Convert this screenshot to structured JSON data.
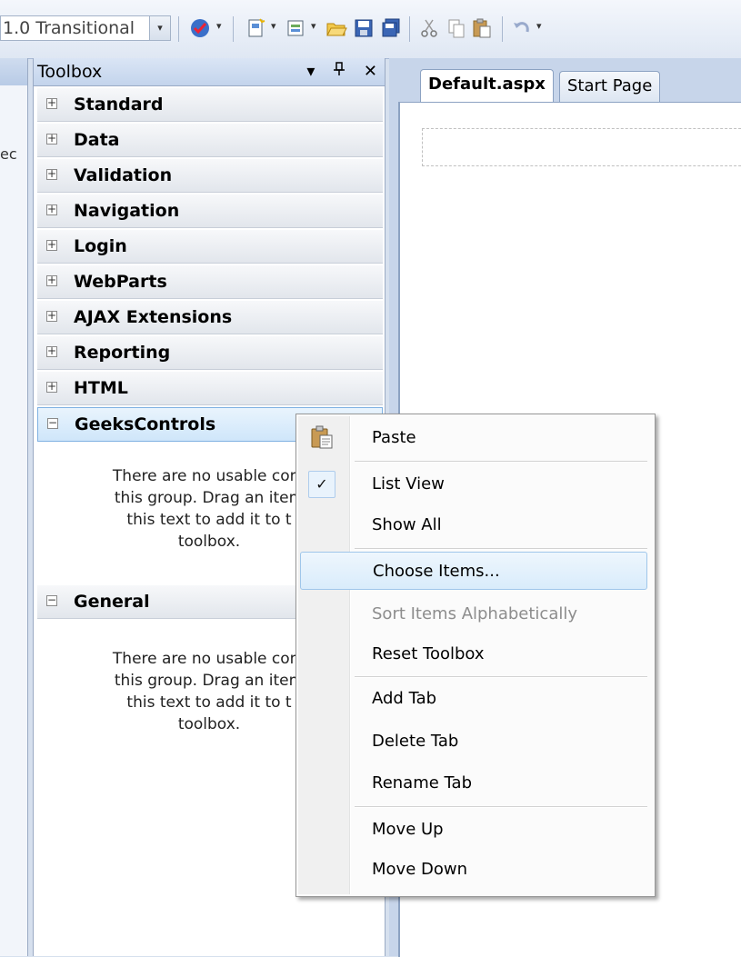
{
  "toolbar": {
    "doctype_value": "1.0 Transitional",
    "dropdown_glyph": "▾",
    "icons": [
      "check-icon",
      "new-project-icon",
      "add-item-icon",
      "open-file-icon",
      "save-icon",
      "save-all-icon",
      "cut-icon",
      "copy-icon",
      "paste-icon",
      "undo-icon"
    ]
  },
  "left_strip": {
    "fragment": "ec"
  },
  "toolbox": {
    "title": "Toolbox",
    "controls": {
      "dropdown": "▾",
      "pin": "ᵃ",
      "close": "✕"
    },
    "categories": [
      {
        "label": "Standard",
        "state": "collapsed"
      },
      {
        "label": "Data",
        "state": "collapsed"
      },
      {
        "label": "Validation",
        "state": "collapsed"
      },
      {
        "label": "Navigation",
        "state": "collapsed"
      },
      {
        "label": "Login",
        "state": "collapsed"
      },
      {
        "label": "WebParts",
        "state": "collapsed"
      },
      {
        "label": "AJAX Extensions",
        "state": "collapsed"
      },
      {
        "label": "Reporting",
        "state": "collapsed"
      },
      {
        "label": "HTML",
        "state": "collapsed"
      },
      {
        "label": "GeeksControls",
        "state": "expanded"
      }
    ],
    "geeks_empty_lines": [
      "There are no usable cont",
      "this group. Drag an item",
      "this text to add it to t",
      "toolbox."
    ],
    "general": {
      "label": "General",
      "state": "expanded"
    },
    "general_empty_lines": [
      "There are no usable cont",
      "this group. Drag an item",
      "this text to add it to t",
      "toolbox."
    ],
    "plus": "+",
    "minus": "−"
  },
  "document": {
    "tabs": [
      {
        "label": "Default.aspx",
        "active": true
      },
      {
        "label": "Start Page",
        "active": false
      }
    ]
  },
  "context_menu": {
    "items": [
      {
        "label": "Paste",
        "icon": "paste-icon"
      },
      {
        "label": "List View",
        "checked": true
      },
      {
        "label": "Show All"
      },
      {
        "label": "Choose Items...",
        "hover": true
      },
      {
        "label": "Sort Items Alphabetically",
        "disabled": true
      },
      {
        "label": "Reset Toolbox"
      },
      {
        "label": "Add Tab"
      },
      {
        "label": "Delete Tab"
      },
      {
        "label": "Rename Tab"
      },
      {
        "label": "Move Up"
      },
      {
        "label": "Move Down"
      }
    ],
    "check_glyph": "✓"
  },
  "colors": {
    "toolbar_bg": "#dfe7f3",
    "menu_hover": "#d9ecfb",
    "selected_category": "#cfe6fa"
  }
}
